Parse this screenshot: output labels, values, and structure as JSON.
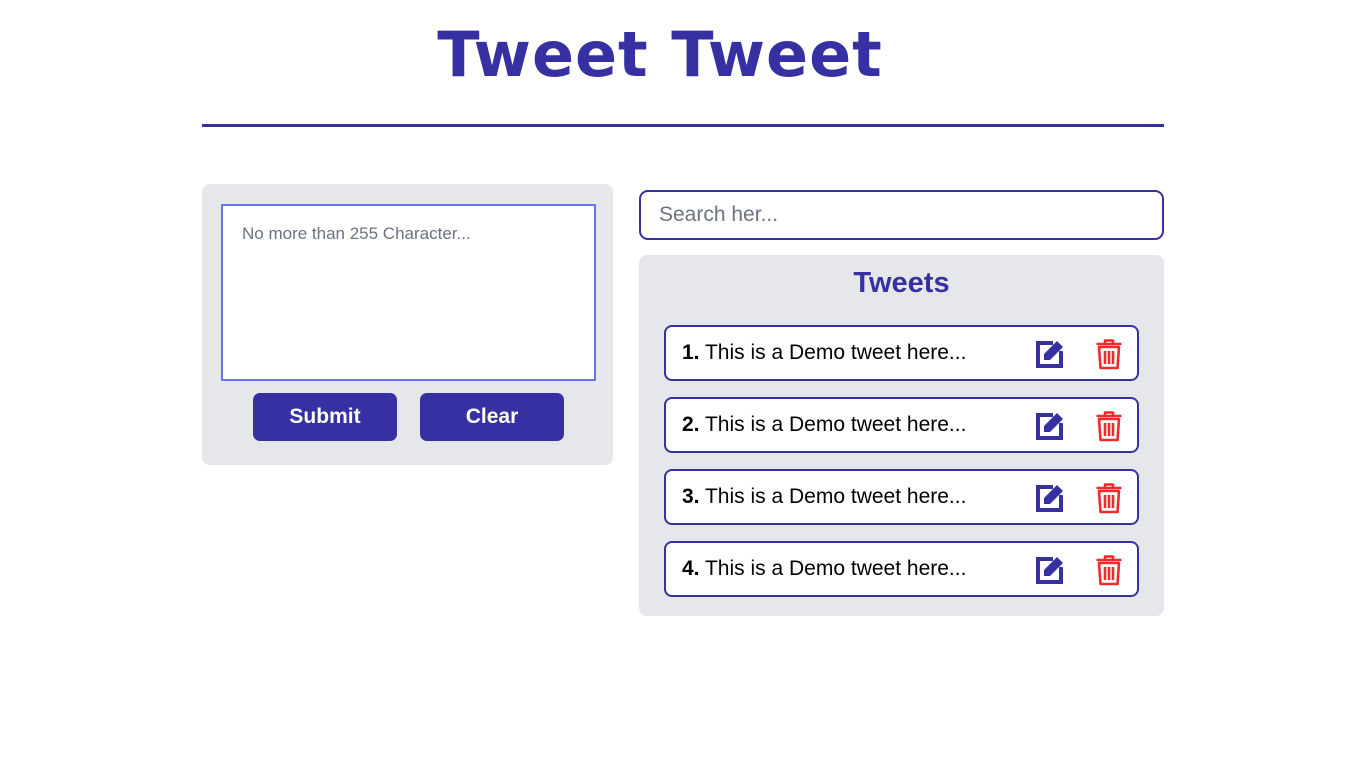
{
  "app": {
    "title": "Tweet Tweet"
  },
  "compose": {
    "placeholder": "No more than 255 Character...",
    "submit_label": "Submit",
    "clear_label": "Clear"
  },
  "search": {
    "placeholder": "Search her..."
  },
  "tweets": {
    "heading": "Tweets",
    "items": [
      {
        "number": "1.",
        "text": "This is a Demo tweet here...",
        "edit_icon": "edit-icon",
        "delete_icon": "trash-icon"
      },
      {
        "number": "2.",
        "text": "This is a Demo tweet here...",
        "edit_icon": "edit-icon",
        "delete_icon": "trash-icon"
      },
      {
        "number": "3.",
        "text": "This is a Demo tweet here...",
        "edit_icon": "edit-icon",
        "delete_icon": "trash-icon"
      },
      {
        "number": "4.",
        "text": "This is a Demo tweet here...",
        "edit_icon": "edit-icon",
        "delete_icon": "trash-icon"
      }
    ]
  },
  "colors": {
    "accent": "#3730a3",
    "panel_bg": "#e5e7eb",
    "textarea_border": "#6674e6",
    "delete_red": "#ef2b2b"
  }
}
